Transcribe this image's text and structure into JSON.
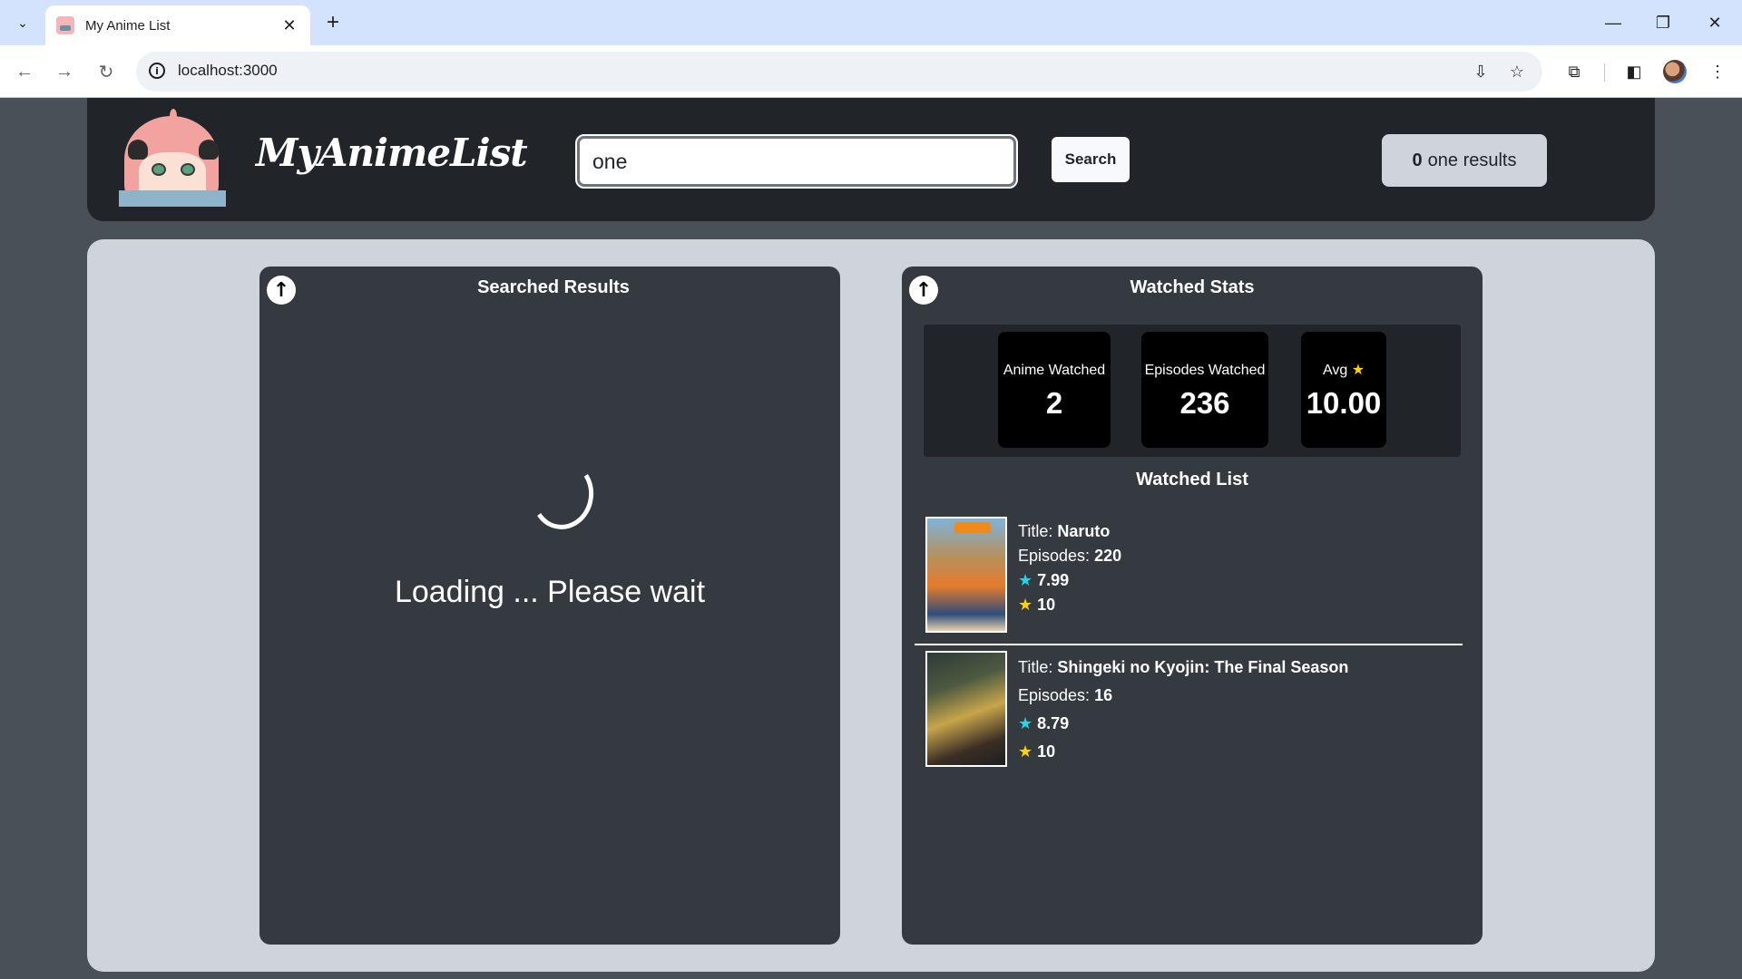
{
  "browser": {
    "tab_title": "My Anime List",
    "url": "localhost:3000"
  },
  "header": {
    "brand": "MyAnimeList",
    "search_value": "one",
    "search_button": "Search",
    "results_count": "0",
    "results_label": "one results"
  },
  "searched": {
    "title": "Searched Results",
    "loading_text": "Loading ... Please wait"
  },
  "stats": {
    "title": "Watched Stats",
    "anime_watched_label": "Anime Watched",
    "anime_watched_value": "2",
    "episodes_watched_label": "Episodes Watched",
    "episodes_watched_value": "236",
    "avg_label": "Avg",
    "avg_value": "10.00"
  },
  "watched": {
    "title": "Watched List",
    "items": [
      {
        "title_label": "Title:",
        "title": "Naruto",
        "episodes_label": "Episodes:",
        "episodes": "220",
        "score": "7.99",
        "user_rating": "10"
      },
      {
        "title_label": "Title:",
        "title": "Shingeki no Kyojin: The Final Season",
        "episodes_label": "Episodes:",
        "episodes": "16",
        "score": "8.79",
        "user_rating": "10"
      }
    ]
  },
  "colors": {
    "page_bg": "#495057",
    "header_bg": "#212529",
    "main_bg": "#ced4da",
    "panel_bg": "#343a40",
    "star_gold": "#ffd200",
    "star_cyan": "#29d3e6"
  },
  "icons": {
    "star": "★",
    "up_arrow": "🡡"
  }
}
